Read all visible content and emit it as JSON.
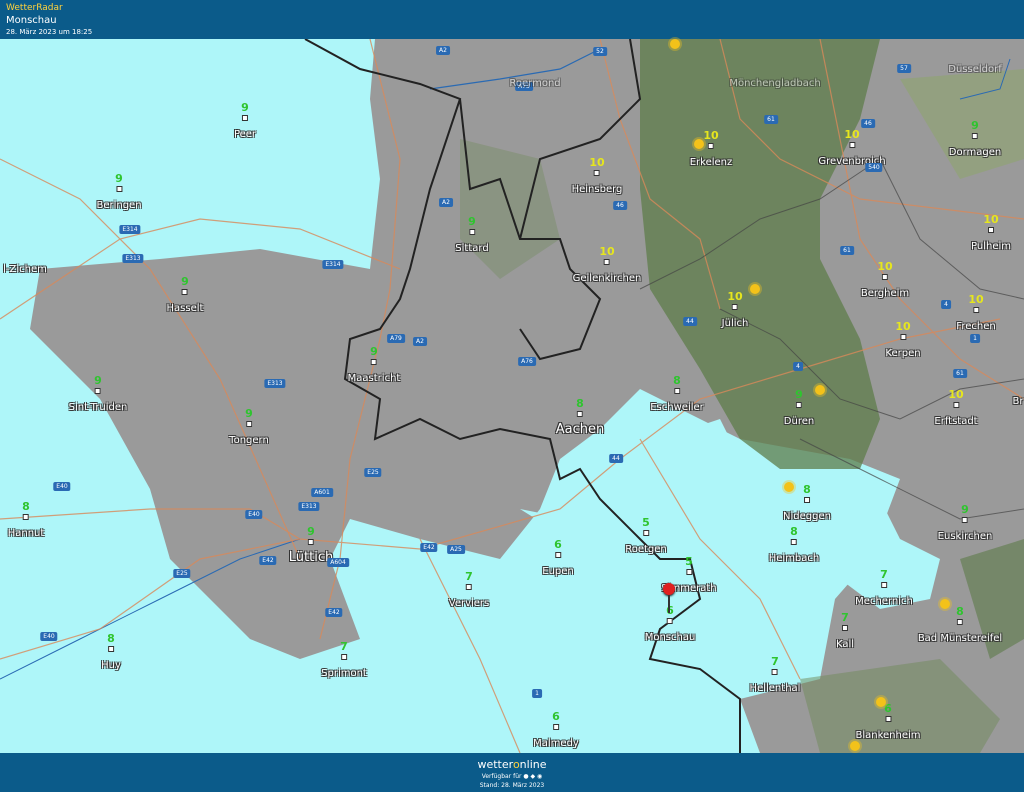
{
  "header": {
    "app": "WetterRadar",
    "location": "Monschau",
    "date": "28. März 2023 um 18:25"
  },
  "footer": {
    "brand_pre": "wetter",
    "brand_o": "o",
    "brand_post": "nline",
    "available": "Verfügbar für ● ◆ ◉",
    "stand": "Stand: 28. März 2023"
  },
  "colors": {
    "green": "#2fc42f",
    "yellow": "#e6e61e",
    "water": "#aef6f9",
    "header": "#0b5b8a"
  },
  "cities": [
    {
      "name": "Peer",
      "val": "9",
      "c": "g"
    },
    {
      "name": "Beringen",
      "val": "9",
      "c": "g"
    },
    {
      "name": "Hasselt",
      "val": "9",
      "c": "g"
    },
    {
      "name": "Sint-Truiden",
      "val": "9",
      "c": "g"
    },
    {
      "name": "Tongern",
      "val": "9",
      "c": "g"
    },
    {
      "name": "Hannut",
      "val": "8",
      "c": "g"
    },
    {
      "name": "Huy",
      "val": "8",
      "c": "g"
    },
    {
      "name": "Lüttich",
      "val": "9",
      "c": "g"
    },
    {
      "name": "Sprimont",
      "val": "7",
      "c": "g"
    },
    {
      "name": "Maastricht",
      "val": "9",
      "c": "g"
    },
    {
      "name": "Sittard",
      "val": "9",
      "c": "g"
    },
    {
      "name": "Heinsberg",
      "val": "10",
      "c": "y"
    },
    {
      "name": "Geilenkirchen",
      "val": "10",
      "c": "y"
    },
    {
      "name": "Erkelenz",
      "val": "10",
      "c": "y"
    },
    {
      "name": "Grevenbroich",
      "val": "10",
      "c": "y"
    },
    {
      "name": "Dormagen",
      "val": "9",
      "c": "g"
    },
    {
      "name": "Pulheim",
      "val": "10",
      "c": "y"
    },
    {
      "name": "Bergheim",
      "val": "10",
      "c": "y"
    },
    {
      "name": "Jülich",
      "val": "10",
      "c": "y"
    },
    {
      "name": "Frechen",
      "val": "10",
      "c": "y"
    },
    {
      "name": "Kerpen",
      "val": "10",
      "c": "y"
    },
    {
      "name": "Erftstadt",
      "val": "10",
      "c": "y"
    },
    {
      "name": "Düren",
      "val": "9",
      "c": "g"
    },
    {
      "name": "Eschweiler",
      "val": "8",
      "c": "g"
    },
    {
      "name": "Aachen",
      "val": "8",
      "c": "g"
    },
    {
      "name": "Nideggen",
      "val": "8",
      "c": "g"
    },
    {
      "name": "Euskirchen",
      "val": "9",
      "c": "g"
    },
    {
      "name": "Heimbach",
      "val": "8",
      "c": "g"
    },
    {
      "name": "Roetgen",
      "val": "5",
      "c": "g"
    },
    {
      "name": "Simmerath",
      "val": "5",
      "c": "g"
    },
    {
      "name": "Monschau",
      "val": "6",
      "c": "g"
    },
    {
      "name": "Eupen",
      "val": "6",
      "c": "g"
    },
    {
      "name": "Verviers",
      "val": "7",
      "c": "g"
    },
    {
      "name": "Mechernich",
      "val": "7",
      "c": "g"
    },
    {
      "name": "Kall",
      "val": "7",
      "c": "g"
    },
    {
      "name": "Bad Münstereifel",
      "val": "8",
      "c": "g"
    },
    {
      "name": "Hellenthal",
      "val": "7",
      "c": "g"
    },
    {
      "name": "Blankenheim",
      "val": "6",
      "c": "g"
    },
    {
      "name": "Malmedy",
      "val": "6",
      "c": "g"
    }
  ],
  "partial_labels": [
    "l-Zichem",
    "Roermond",
    "Mönchengladbach",
    "Düsseldorf",
    "Br"
  ],
  "roads": [
    "A2",
    "A73",
    "52",
    "57",
    "61",
    "46",
    "540",
    "A2",
    "46",
    "E314",
    "E313",
    "E314",
    "61",
    "4",
    "A79",
    "A2",
    "A76",
    "44",
    "4",
    "1",
    "61",
    "E313",
    "44",
    "E25",
    "A601",
    "E313",
    "E40",
    "E40",
    "E42",
    "A25",
    "A604",
    "E42",
    "E25",
    "E42",
    "E40",
    "1"
  ]
}
